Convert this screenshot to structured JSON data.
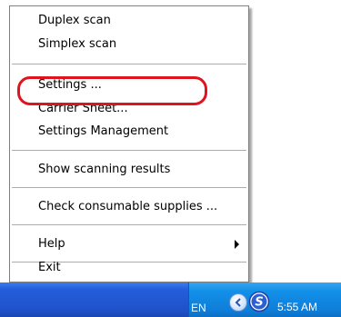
{
  "context_menu": {
    "items": [
      {
        "label": "Duplex scan"
      },
      {
        "label": "Simplex scan"
      },
      {
        "label": "Settings ..."
      },
      {
        "label": "Carrier Sheet..."
      },
      {
        "label": "Settings Management"
      },
      {
        "label": "Show scanning results"
      },
      {
        "label": "Check consumable supplies ..."
      },
      {
        "label": "Help"
      },
      {
        "label": "Exit"
      }
    ],
    "highlighted_item": "Settings ..."
  },
  "taskbar": {
    "language": "EN",
    "clock": "5:55 AM",
    "tray_icons": [
      "show-hidden-icons-chevron",
      "scanner-s-icon"
    ]
  },
  "colors": {
    "highlight_ring": "#e0141e",
    "taskbar_blue": "#245edb",
    "tray_blue": "#1290e8"
  }
}
